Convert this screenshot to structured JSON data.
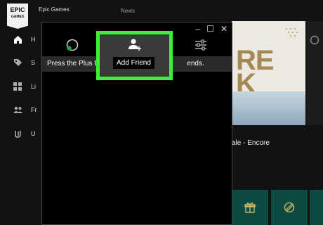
{
  "app": {
    "logo_top": "EPIC",
    "logo_bottom": "GAMES",
    "title": "Epic Games"
  },
  "header": {
    "section": "News"
  },
  "sidebar": {
    "items": [
      {
        "label": "H",
        "icon": "home-icon"
      },
      {
        "label": "S",
        "icon": "tag-icon"
      },
      {
        "label": "Li",
        "icon": "grid-icon"
      },
      {
        "label": "Fr",
        "icon": "people-icon"
      },
      {
        "label": "U",
        "icon": "unreal-icon"
      }
    ]
  },
  "store": {
    "featured_text_line1": "RE",
    "featured_text_line2": "K",
    "featured_caption": "ale - Encore"
  },
  "friends_window": {
    "controls": {
      "minimize": "–",
      "maximize": "☐",
      "close": "✕"
    },
    "instruction": "Press the Plus But",
    "instruction_tail": "ends.",
    "tooltip": "Add Friend"
  },
  "colors": {
    "highlight": "#3cf03c",
    "status_online": "#1fa83a"
  }
}
